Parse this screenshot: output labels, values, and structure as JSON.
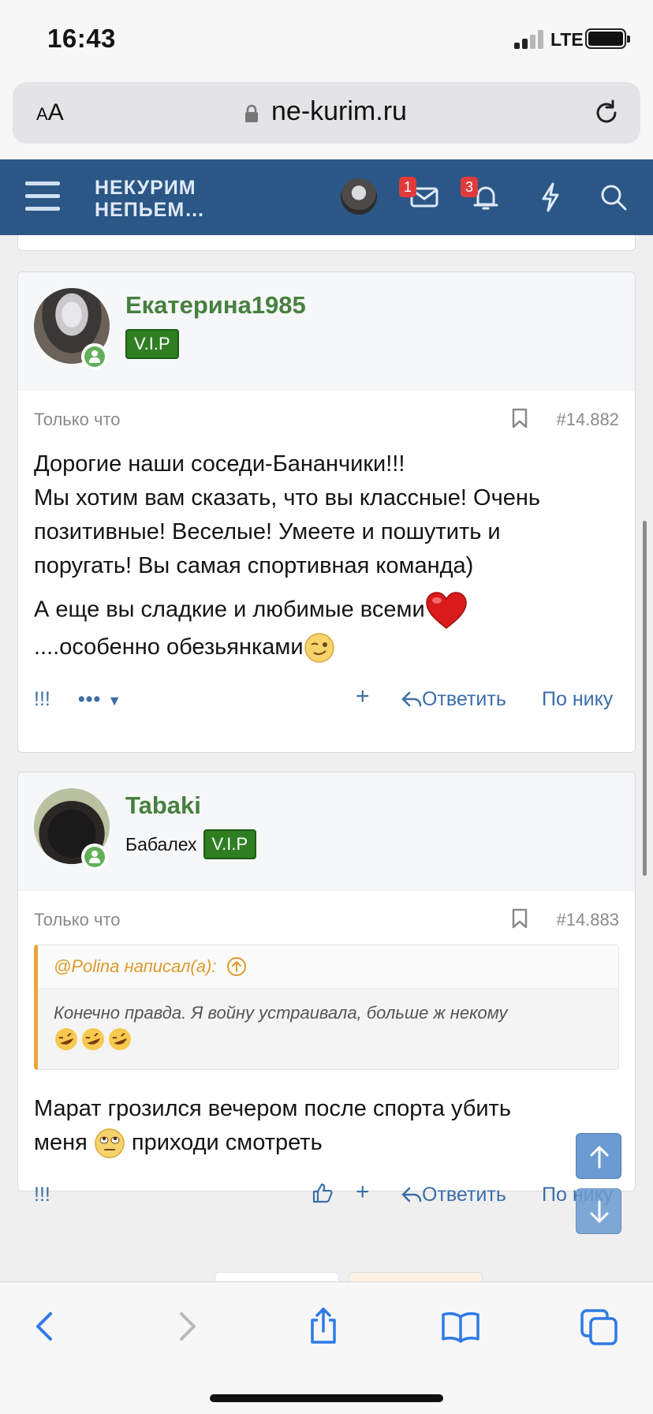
{
  "status": {
    "time": "16:43",
    "network": "LTE"
  },
  "browser": {
    "aa_label": "AA",
    "host": "ne-kurim.ru"
  },
  "site": {
    "logo_line1": "НЕКУРИМ",
    "logo_line2": "НЕПЬЕМ…",
    "inbox_count": "1",
    "alerts_count": "3"
  },
  "posts": [
    {
      "username": "Екатерина1985",
      "user_title": "",
      "badge": "V.I.P",
      "time": "Только что",
      "number": "#14.882",
      "paragraph1_lines": [
        "Дорогие наши соседи-Бананчики!!!",
        "Мы хотим вам сказать, что вы классные! Очень",
        "позитивные! Веселые! Умеете и пошутить и",
        "поругать! Вы самая спортивная команда)"
      ],
      "paragraph2_line1": "А еще вы сладкие и любимые всеми",
      "paragraph2_line2": "....особенно обезьянками",
      "actions": {
        "react": "!!!",
        "more": "•••",
        "plus": "+",
        "reply": "Ответить",
        "by_nick": "По нику"
      }
    },
    {
      "username": "Tabaki",
      "user_title": "Бабалех",
      "badge": "V.I.P",
      "time": "Только что",
      "number": "#14.883",
      "quote": {
        "author": "@Polina написал(а):",
        "text": "Конечно правда. Я войну устраивала, больше ж некому"
      },
      "body_line1": "Марат грозился вечером после спорта убить",
      "body_line2_a": "меня",
      "body_line2_b": "приходи смотреть",
      "actions": {
        "react": "!!!",
        "plus": "+",
        "reply": "Ответить",
        "by_nick": "По нику"
      }
    }
  ],
  "colors": {
    "header": "#2b5786",
    "username": "#47803f",
    "vip": "#2f7f22",
    "link": "#3c6ea8",
    "quote_accent": "#e7a73a"
  },
  "icons": [
    "menu-icon",
    "mail-icon",
    "bell-icon",
    "bolt-icon",
    "search-icon",
    "lock-icon",
    "reload-icon",
    "bookmark-icon",
    "reply-icon",
    "like-icon",
    "back-icon",
    "forward-icon",
    "share-icon",
    "bookmarks-icon",
    "tabs-icon"
  ]
}
